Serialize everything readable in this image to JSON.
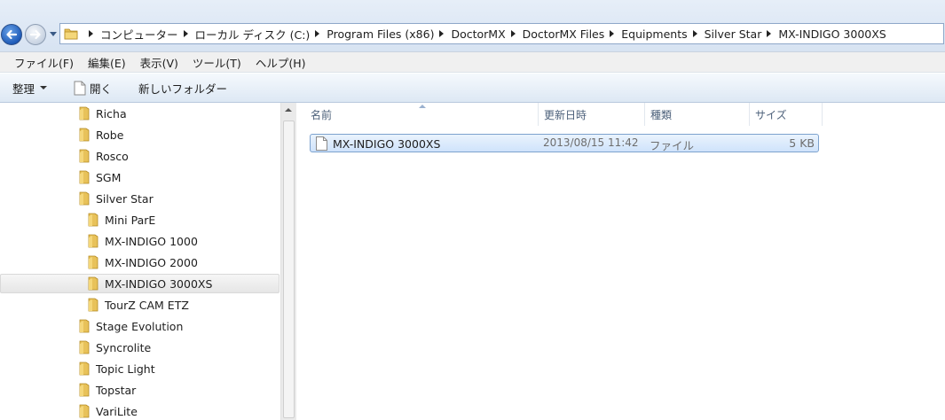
{
  "address": {
    "crumbs": [
      "コンピューター",
      "ローカル ディスク (C:)",
      "Program Files (x86)",
      "DoctorMX",
      "DoctorMX Files",
      "Equipments",
      "Silver Star",
      "MX-INDIGO 3000XS"
    ]
  },
  "menu": {
    "file": "ファイル(F)",
    "edit": "編集(E)",
    "view": "表示(V)",
    "tools": "ツール(T)",
    "help": "ヘルプ(H)"
  },
  "toolbar": {
    "organize": "整理",
    "open": "開く",
    "new_folder": "新しいフォルダー"
  },
  "tree": {
    "items": [
      {
        "label": "Richa"
      },
      {
        "label": "Robe"
      },
      {
        "label": "Rosco"
      },
      {
        "label": "SGM"
      },
      {
        "label": "Silver Star"
      },
      {
        "label": "Mini ParE"
      },
      {
        "label": "MX-INDIGO 1000"
      },
      {
        "label": "MX-INDIGO 2000"
      },
      {
        "label": "MX-INDIGO 3000XS"
      },
      {
        "label": "TourZ CAM ETZ"
      },
      {
        "label": "Stage Evolution"
      },
      {
        "label": "Syncrolite"
      },
      {
        "label": "Topic Light"
      },
      {
        "label": "Topstar"
      },
      {
        "label": "VariLite"
      }
    ],
    "selected": "MX-INDIGO 3000XS"
  },
  "columns": {
    "name": "名前",
    "date": "更新日時",
    "type": "種類",
    "size": "サイズ"
  },
  "files": [
    {
      "name": "MX-INDIGO 3000XS",
      "date": "2013/08/15 11:42",
      "type": "ファイル",
      "size": "5 KB"
    }
  ],
  "colors": {
    "selection_fill": "#cfe3fb",
    "selection_border": "#7da2ce",
    "folder": "#e8c25a",
    "header_text": "#4c607a"
  }
}
